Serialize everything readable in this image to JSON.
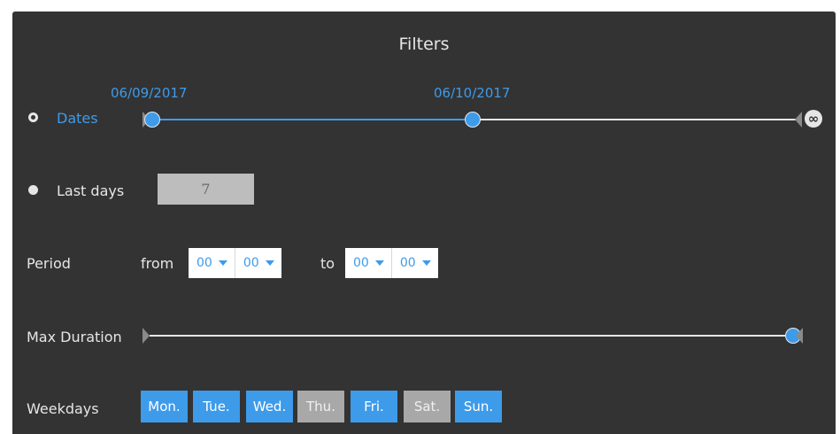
{
  "filters": {
    "title": "Filters",
    "dates": {
      "label": "Dates",
      "start_label": "06/09/2017",
      "end_label": "06/10/2017",
      "infinity_symbol": "∞",
      "selected": true
    },
    "last_days": {
      "label": "Last days",
      "value": "7",
      "selected": false
    },
    "period": {
      "label": "Period",
      "from_label": "from",
      "to_label": "to",
      "from_hour": "00",
      "from_minute": "00",
      "to_hour": "00",
      "to_minute": "00"
    },
    "max_duration": {
      "label": "Max Duration",
      "value_fraction": 1.0
    },
    "weekdays": {
      "label": "Weekdays",
      "days": [
        {
          "label": "Mon.",
          "active": true
        },
        {
          "label": "Tue.",
          "active": true
        },
        {
          "label": "Wed.",
          "active": true
        },
        {
          "label": "Thu.",
          "active": false
        },
        {
          "label": "Fri.",
          "active": true
        },
        {
          "label": "Sat.",
          "active": false
        },
        {
          "label": "Sun.",
          "active": true
        }
      ]
    },
    "colors": {
      "accent": "#3e9bea",
      "panel_bg": "#333333",
      "inactive_day": "#a8a8a8"
    }
  }
}
